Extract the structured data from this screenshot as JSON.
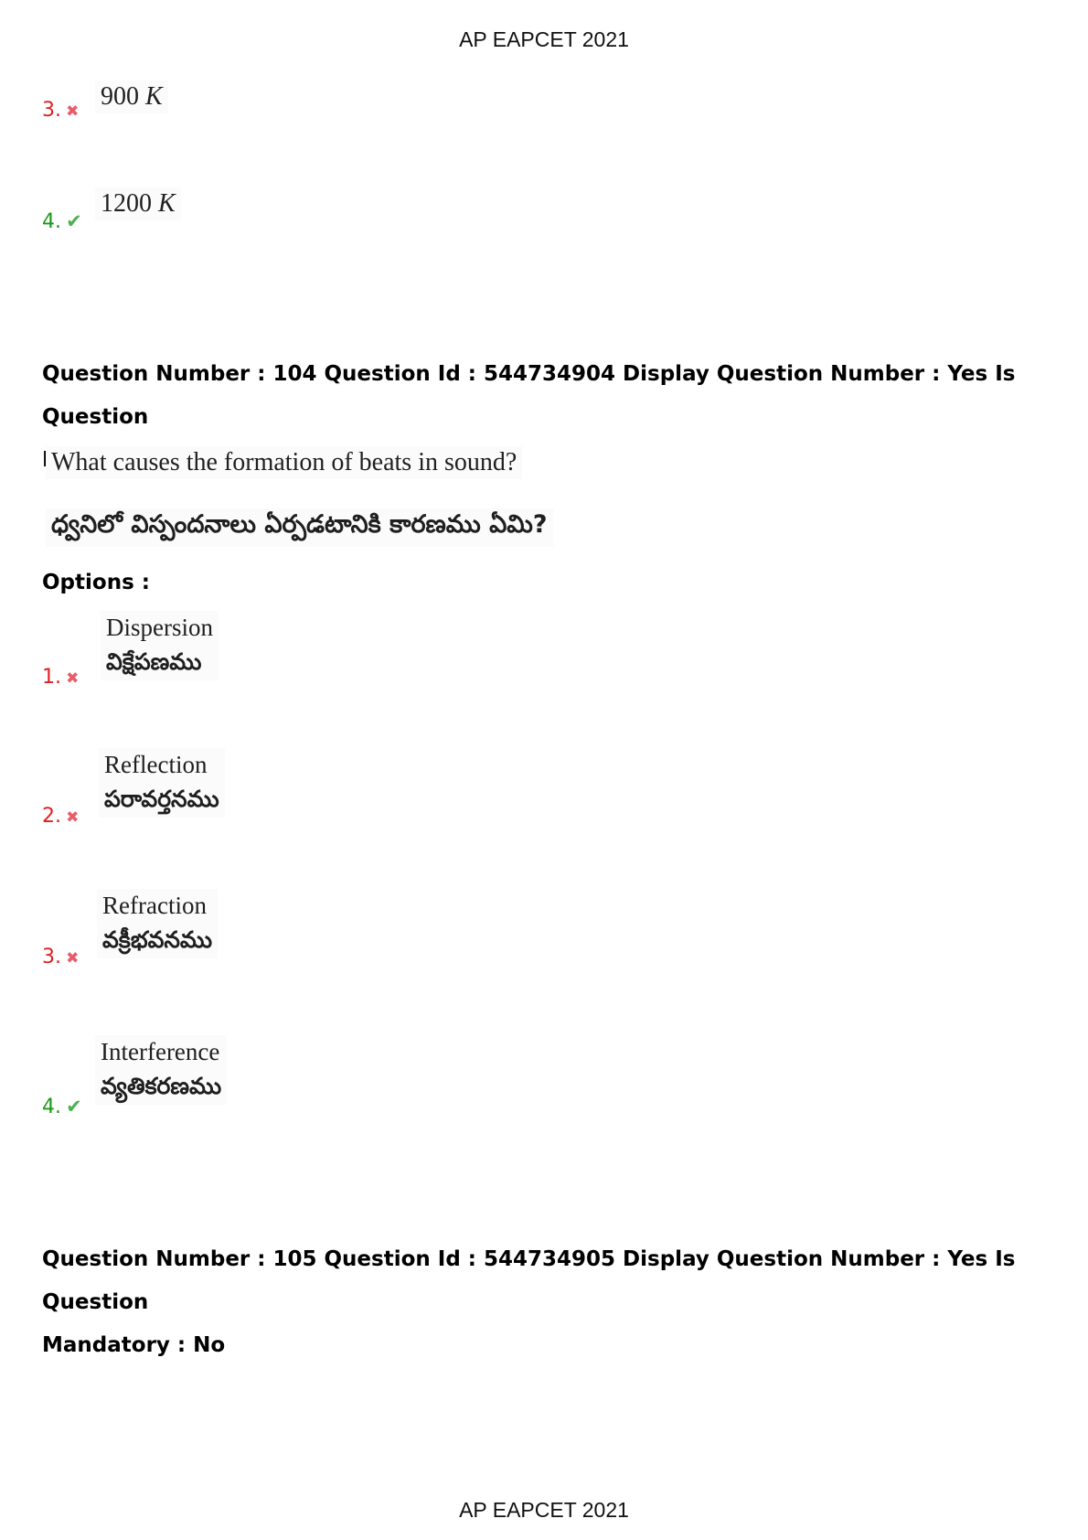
{
  "page": {
    "header": "AP EAPCET 2021",
    "footer": "AP EAPCET 2021"
  },
  "prev_question": {
    "options": [
      {
        "number": "3.",
        "status": "wrong",
        "mark_icon": "cross-icon",
        "value": "900",
        "unit": "K"
      },
      {
        "number": "4.",
        "status": "correct",
        "mark_icon": "check-icon",
        "value": "1200",
        "unit": "K"
      }
    ]
  },
  "question_104": {
    "header_line1": "Question Number : 104 Question Id : 544734904 Display Question Number : Yes Is Question",
    "header_line2": "Mandatory : No",
    "text_en": "What causes the formation of beats in sound?",
    "text_te": "ధ్వనిలో విస్పందనాలు ఏర్పడటానికి కారణము ఏమి?",
    "options_label": "Options :",
    "options": [
      {
        "number": "1.",
        "status": "wrong",
        "mark_icon": "cross-icon",
        "en": "Dispersion",
        "te": "విక్షేపణము"
      },
      {
        "number": "2.",
        "status": "wrong",
        "mark_icon": "cross-icon",
        "en": "Reflection",
        "te": "పరావర్తనము"
      },
      {
        "number": "3.",
        "status": "wrong",
        "mark_icon": "cross-icon",
        "en": "Refraction",
        "te": "వక్రీభవనము"
      },
      {
        "number": "4.",
        "status": "correct",
        "mark_icon": "check-icon",
        "en": "Interference",
        "te": "వ్యతికరణము"
      }
    ]
  },
  "question_105": {
    "header_line1": "Question Number : 105 Question Id : 544734905 Display Question Number : Yes Is Question",
    "header_line2": "Mandatory : No"
  },
  "colors": {
    "wrong": "#e02020",
    "correct": "#1a9a1a"
  }
}
